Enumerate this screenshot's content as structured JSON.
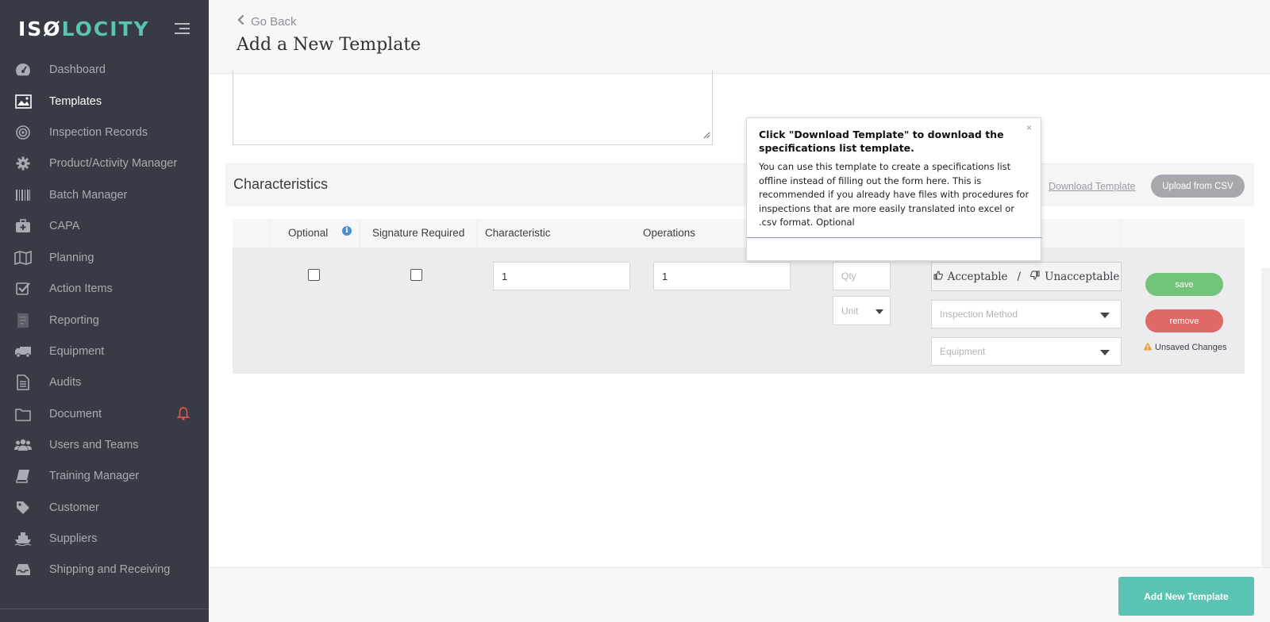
{
  "app": {
    "logo_left": "ISØ",
    "logo_right": "LOCITY"
  },
  "sidebar": {
    "items": [
      {
        "label": "Dashboard",
        "icon": "dashboard-icon",
        "active": false
      },
      {
        "label": "Templates",
        "icon": "image-icon",
        "active": true
      },
      {
        "label": "Inspection Records",
        "icon": "target-icon",
        "active": false
      },
      {
        "label": "Product/Activity Manager",
        "icon": "gear-icon",
        "active": false
      },
      {
        "label": "Batch Manager",
        "icon": "barcode-icon",
        "active": false
      },
      {
        "label": "CAPA",
        "icon": "medkit-icon",
        "active": false
      },
      {
        "label": "Planning",
        "icon": "map-icon",
        "active": false
      },
      {
        "label": "Action Items",
        "icon": "check-square-icon",
        "active": false
      },
      {
        "label": "Reporting",
        "icon": "report-icon",
        "active": false
      },
      {
        "label": "Equipment",
        "icon": "truck-icon",
        "active": false
      },
      {
        "label": "Audits",
        "icon": "document-icon",
        "active": false
      },
      {
        "label": "Document",
        "icon": "folder-icon",
        "active": false
      },
      {
        "label": "Users and Teams",
        "icon": "users-icon",
        "active": false
      },
      {
        "label": "Training Manager",
        "icon": "book-icon",
        "active": false
      },
      {
        "label": "Customer",
        "icon": "tag-icon",
        "active": false
      },
      {
        "label": "Suppliers",
        "icon": "ship-icon",
        "active": false
      },
      {
        "label": "Shipping and Receiving",
        "icon": "inbox-icon",
        "active": false
      }
    ]
  },
  "header": {
    "back_label": "Go Back",
    "title": "Add a New Template"
  },
  "characteristics": {
    "title": "Characteristics",
    "download_link": "Download Template",
    "upload_button": "Upload from CSV"
  },
  "table": {
    "headers": {
      "optional": "Optional",
      "signature_required": "Signature Required",
      "characteristic": "Characteristic",
      "operations": "Operations"
    },
    "row": {
      "characteristic_value": "1",
      "operations_value": "1",
      "qty_placeholder": "Qty",
      "unit_placeholder": "Unit",
      "acceptable_label": "Acceptable",
      "separator": "/",
      "unacceptable_label": "Unacceptable",
      "inspection_method_placeholder": "Inspection Method",
      "equipment_placeholder": "Equipment",
      "save_label": "save",
      "remove_label": "remove",
      "unsaved_label": "Unsaved Changes"
    }
  },
  "tooltip": {
    "close": "×",
    "title": "Click \"Download Template\" to download the specifications list template.",
    "body": "You can use this template to create a specifications list offline instead of filling out the form here. This is recommended if you already have files with procedures for inspections that are more easily translated into excel or .csv format. Optional"
  },
  "footer": {
    "add_button": "Add New Template"
  },
  "colors": {
    "sidebar_bg": "#383a45",
    "accent_teal": "#5ac3b4",
    "save_green": "#72c47b",
    "remove_red": "#e06866",
    "bell_red": "#d9534f"
  }
}
